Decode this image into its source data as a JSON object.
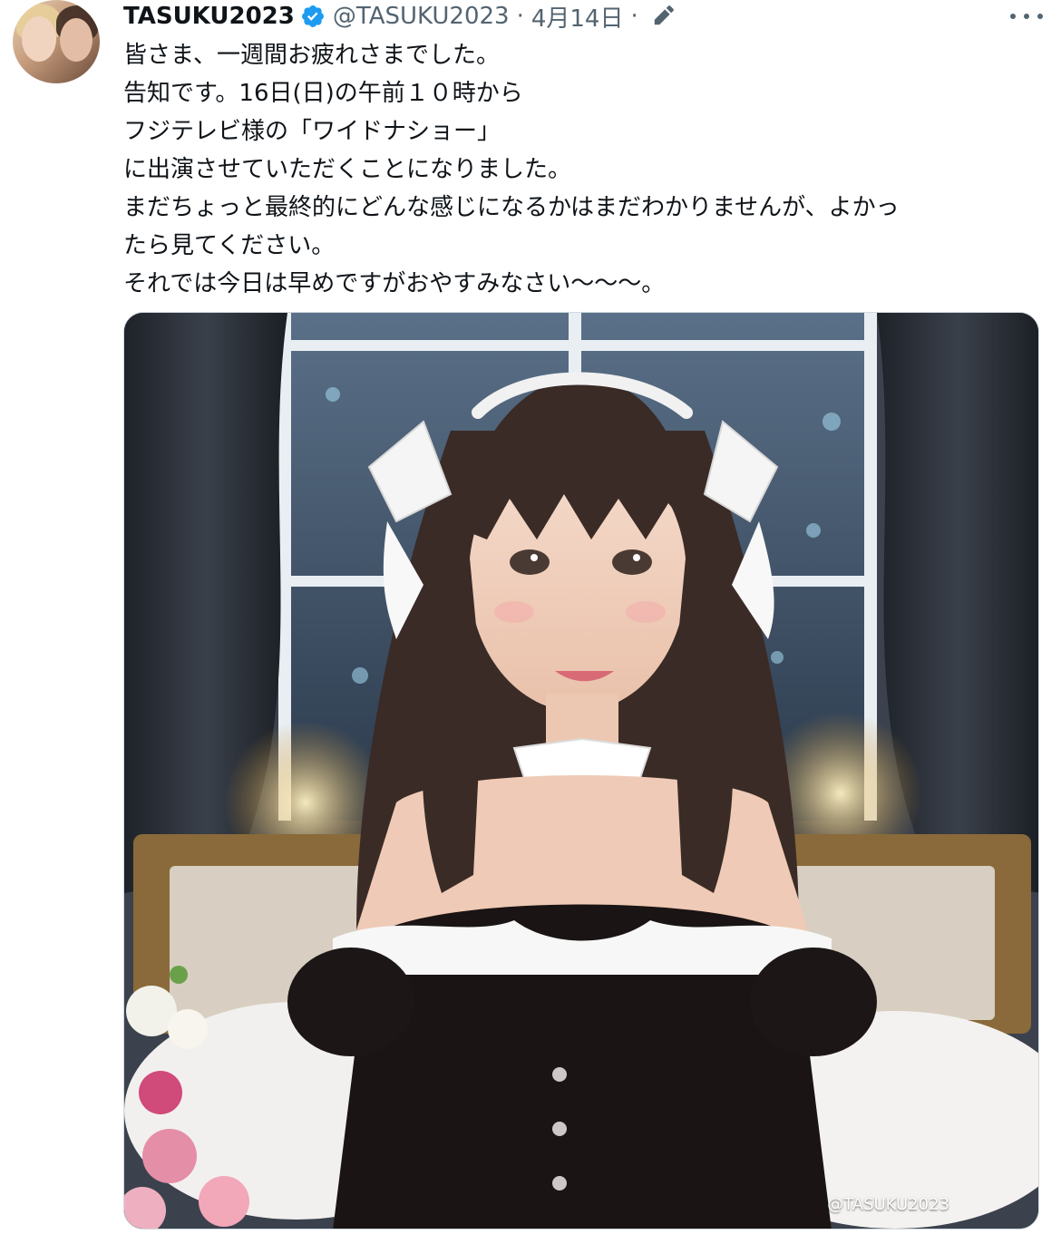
{
  "tweet": {
    "display_name": "TASUKU2023",
    "handle": "@TASUKU2023",
    "separator": "·",
    "date": "4月14日",
    "separator2": "·",
    "lines": [
      "皆さま、一週間お疲れさまでした。",
      "告知です。16日(日)の午前１０時から",
      "フジテレビ様の「ワイドナショー」",
      "に出演させていただくことになりました。",
      "まだちょっと最終的にどんな感じになるかはまだわかりませんが、よかっ",
      "たら見てください。",
      "それでは今日は早めですがおやすみなさい〜〜〜。"
    ],
    "media_watermark": "@TASUKU2023"
  },
  "colors": {
    "verified_blue": "#1d9bf0",
    "text_primary": "#0f1419",
    "text_secondary": "#536471"
  },
  "icons": {
    "verified": "verified-badge-icon",
    "edit": "edited-pencil-icon",
    "more": "more-options-icon"
  }
}
